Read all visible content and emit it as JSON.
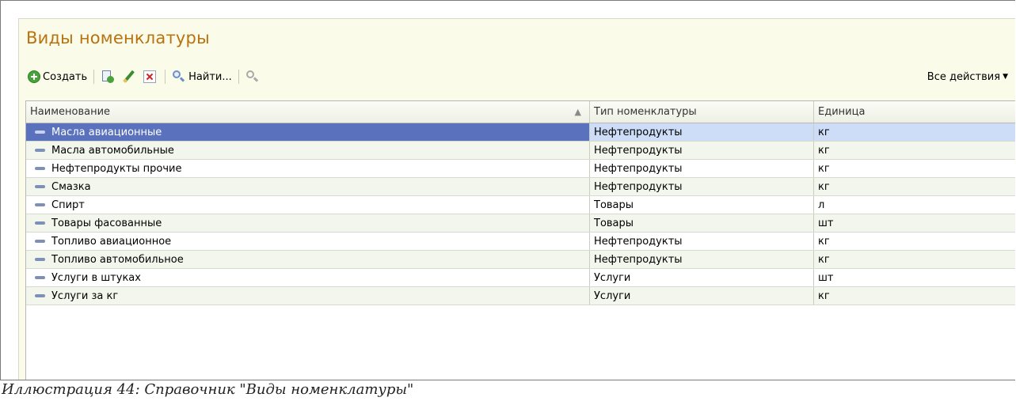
{
  "form": {
    "title": "Виды номенклатуры"
  },
  "toolbar": {
    "create_label": "Создать",
    "find_label": "Найти...",
    "all_actions_label": "Все действия",
    "icons": [
      "add-circle-icon",
      "copy-icon",
      "pencil-icon",
      "delete-icon",
      "search-icon",
      "cancel-search-icon"
    ]
  },
  "table": {
    "columns": [
      "Наименование",
      "Тип номенклатуры",
      "Единица"
    ],
    "rows": [
      [
        "Масла авиационные",
        "Нефтепродукты",
        "кг"
      ],
      [
        "Масла автомобильные",
        "Нефтепродукты",
        "кг"
      ],
      [
        "Нефтепродукты прочие",
        "Нефтепродукты",
        "кг"
      ],
      [
        "Смазка",
        "Нефтепродукты",
        "кг"
      ],
      [
        "Спирт",
        "Товары",
        "л"
      ],
      [
        "Товары фасованные",
        "Товары",
        "шт"
      ],
      [
        "Топливо авиационное",
        "Нефтепродукты",
        "кг"
      ],
      [
        "Топливо автомобильное",
        "Нефтепродукты",
        "кг"
      ],
      [
        "Услуги в штуках",
        "Услуги",
        "шт"
      ],
      [
        "Услуги за кг",
        "Услуги",
        "кг"
      ]
    ],
    "selected_row": 0
  },
  "caption": "Иллюстрация 44: Справочник \"Виды номенклатуры\"",
  "colors": {
    "title": "#b8730e",
    "selection": "#5a72bd",
    "selection_light": "#cddcf7"
  }
}
